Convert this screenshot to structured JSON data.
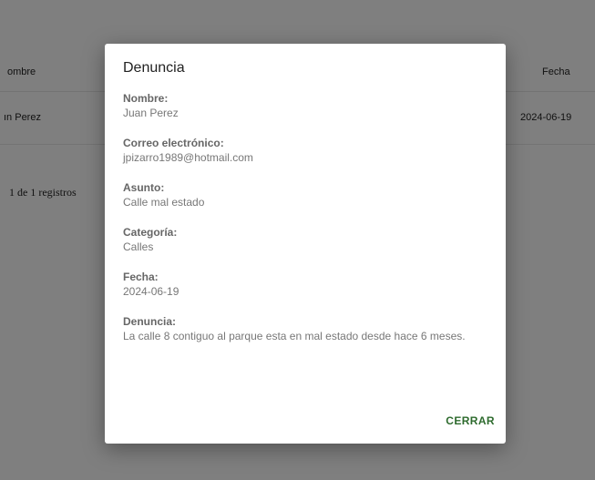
{
  "table": {
    "col_nombre": "ombre",
    "col_fecha": "Fecha",
    "row": {
      "nombre": "ın Perez",
      "fecha": "2024-06-19"
    },
    "footer": "1 de 1 registros"
  },
  "modal": {
    "title": "Denuncia",
    "fields": [
      {
        "label": "Nombre:",
        "value": "Juan Perez"
      },
      {
        "label": "Correo electrónico:",
        "value": "jpizarro1989@hotmail.com"
      },
      {
        "label": "Asunto:",
        "value": "Calle mal estado"
      },
      {
        "label": "Categoría:",
        "value": "Calles"
      },
      {
        "label": "Fecha:",
        "value": "2024-06-19"
      },
      {
        "label": "Denuncia:",
        "value": "La calle 8 contiguo al parque esta en mal estado desde hace 6 meses."
      }
    ],
    "close_label": "CERRAR"
  },
  "colors": {
    "overlay": "rgba(0,0,0,0.5)",
    "accent": "#2e6b2e"
  }
}
